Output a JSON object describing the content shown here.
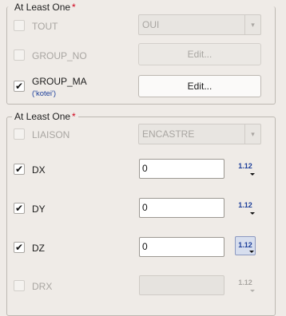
{
  "group1": {
    "legend": "At Least One",
    "required_mark": "*",
    "rows": [
      {
        "label": "TOUT",
        "checked": false,
        "enabled": false,
        "combo_value": "OUI",
        "combo_arrow": "▾"
      },
      {
        "label": "GROUP_NO",
        "checked": false,
        "enabled": false,
        "button_label": "Edit..."
      },
      {
        "label": "GROUP_MA",
        "checked": true,
        "enabled": true,
        "sublabel": "('kotei')",
        "button_label": "Edit..."
      }
    ]
  },
  "group2": {
    "legend": "At Least One",
    "required_mark": "*",
    "rows": [
      {
        "label": "LIAISON",
        "checked": false,
        "enabled": false,
        "combo_value": "ENCASTRE",
        "combo_arrow": "▾"
      },
      {
        "label": "DX",
        "checked": true,
        "enabled": true,
        "value": "0",
        "format_label": "1.12"
      },
      {
        "label": "DY",
        "checked": true,
        "enabled": true,
        "value": "0",
        "format_label": "1.12"
      },
      {
        "label": "DZ",
        "checked": true,
        "enabled": true,
        "value": "0",
        "format_label": "1.12"
      },
      {
        "label": "DRX",
        "checked": false,
        "enabled": false,
        "value": "",
        "format_label": "1.12"
      }
    ]
  },
  "check_glyph": "✔"
}
